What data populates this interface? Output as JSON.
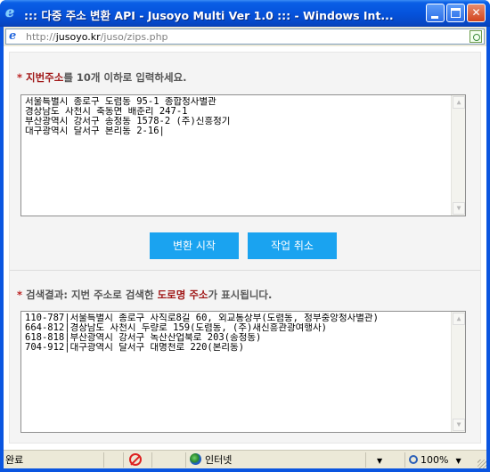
{
  "window": {
    "title": "::: 다중 주소 변환 API - Jusoyo Multi Ver 1.0 ::: - Windows Int...",
    "minimize_label": "",
    "maximize_label": "",
    "close_label": "✕"
  },
  "address": {
    "prefix": "http://",
    "host": "jusoyo.kr",
    "path": "/juso/zips.php"
  },
  "input_section": {
    "star": "*",
    "label_accent": "지번주소",
    "label_rest": "를 10개 이하로 입력하세요.",
    "lines": [
      "서울특별시 종로구 도렴동 95-1 종합청사별관",
      "경상남도 사천시 축동면 배춘리 247-1",
      "부산광역시 강서구 송정동 1578-2 (주)신흥정기",
      "대구광역시 달서구 본리동 2-16|"
    ]
  },
  "buttons": {
    "start": "변환 시작",
    "cancel": "작업 취소"
  },
  "result_section": {
    "star": "*",
    "label_prefix": "검색결과: 지번 주소로 검색한 ",
    "label_accent": "도로명 주소",
    "label_suffix": "가 표시됩니다.",
    "lines": [
      "110-787|서울특별시 종로구 사직로8길 60, 외교통상부(도렴동, 정부중앙청사별관)",
      "664-812|경상남도 사천시 두량로 159(도렴동, (주)새신흥관광여행사)",
      "618-818|부산광역시 강서구 녹산산업북로 203(송정동)",
      "704-912|대구광역시 달서구 대명천로 220(본리동)"
    ]
  },
  "status": {
    "text": "완료",
    "zone": "인터넷",
    "zoom": "100%"
  },
  "colors": {
    "button_bg": "#1aa3f0",
    "label_accent": "#a01818",
    "titlebar": "#0553dc"
  },
  "icons": {
    "title": "ie-logo-icon",
    "address": "ie-page-icon",
    "zone": "globe-icon",
    "privacy": "privacy-blocked-icon",
    "zoom": "zoom-icon"
  }
}
